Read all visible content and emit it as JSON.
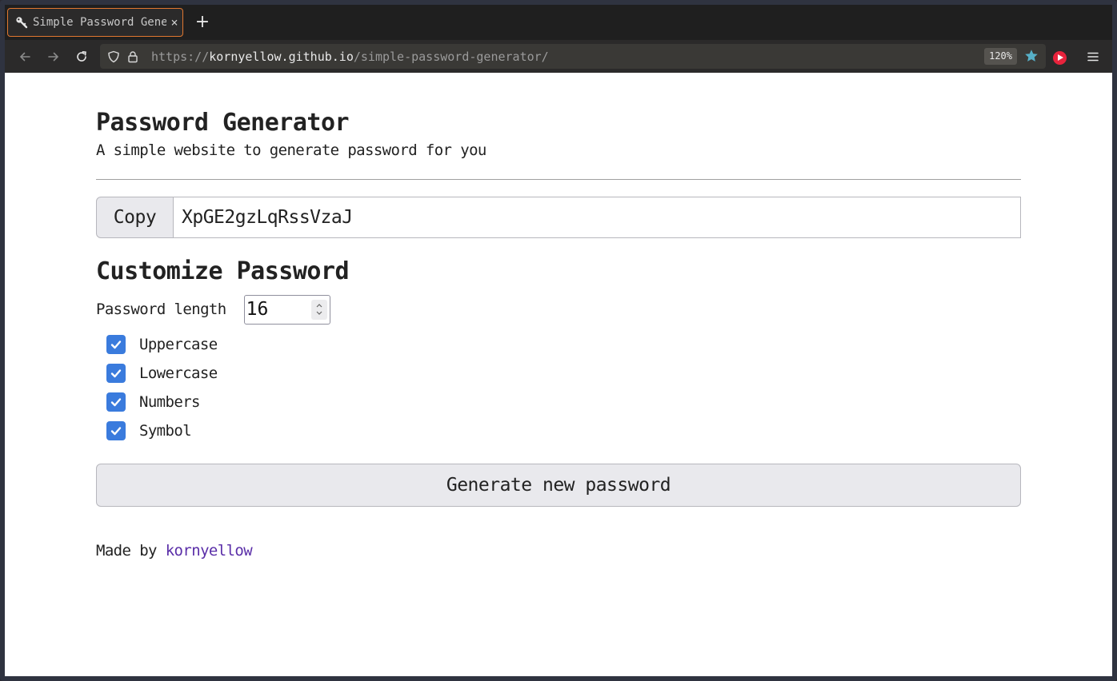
{
  "browser": {
    "tab": {
      "title": "Simple Password Gener",
      "favicon": "key-icon",
      "close_glyph": "×"
    },
    "new_tab_glyph": "+",
    "url": {
      "scheme": "https://",
      "host": "kornyellow.github.io",
      "path": "/simple-password-generator/"
    },
    "zoom": "120%",
    "icons": [
      "back-icon",
      "forward-icon",
      "reload-icon",
      "shield-icon",
      "lock-icon",
      "star-icon",
      "extension-icon",
      "menu-icon"
    ]
  },
  "page": {
    "title": "Password Generator",
    "subtitle": "A simple website to generate password for you",
    "copy_label": "Copy",
    "password": "XpGE2gzLqRssVzaJ",
    "customize_title": "Customize Password",
    "length_label": "Password length",
    "length_value": "16",
    "options": [
      {
        "label": "Uppercase",
        "checked": true
      },
      {
        "label": "Lowercase",
        "checked": true
      },
      {
        "label": "Numbers",
        "checked": true
      },
      {
        "label": "Symbol",
        "checked": true
      }
    ],
    "generate_label": "Generate new password",
    "footer": {
      "prefix": "Made by ",
      "link": "kornyellow"
    }
  },
  "colors": {
    "accent": "#3a7bdd",
    "link": "#5a2ea8",
    "tab_border": "#e0772f"
  }
}
